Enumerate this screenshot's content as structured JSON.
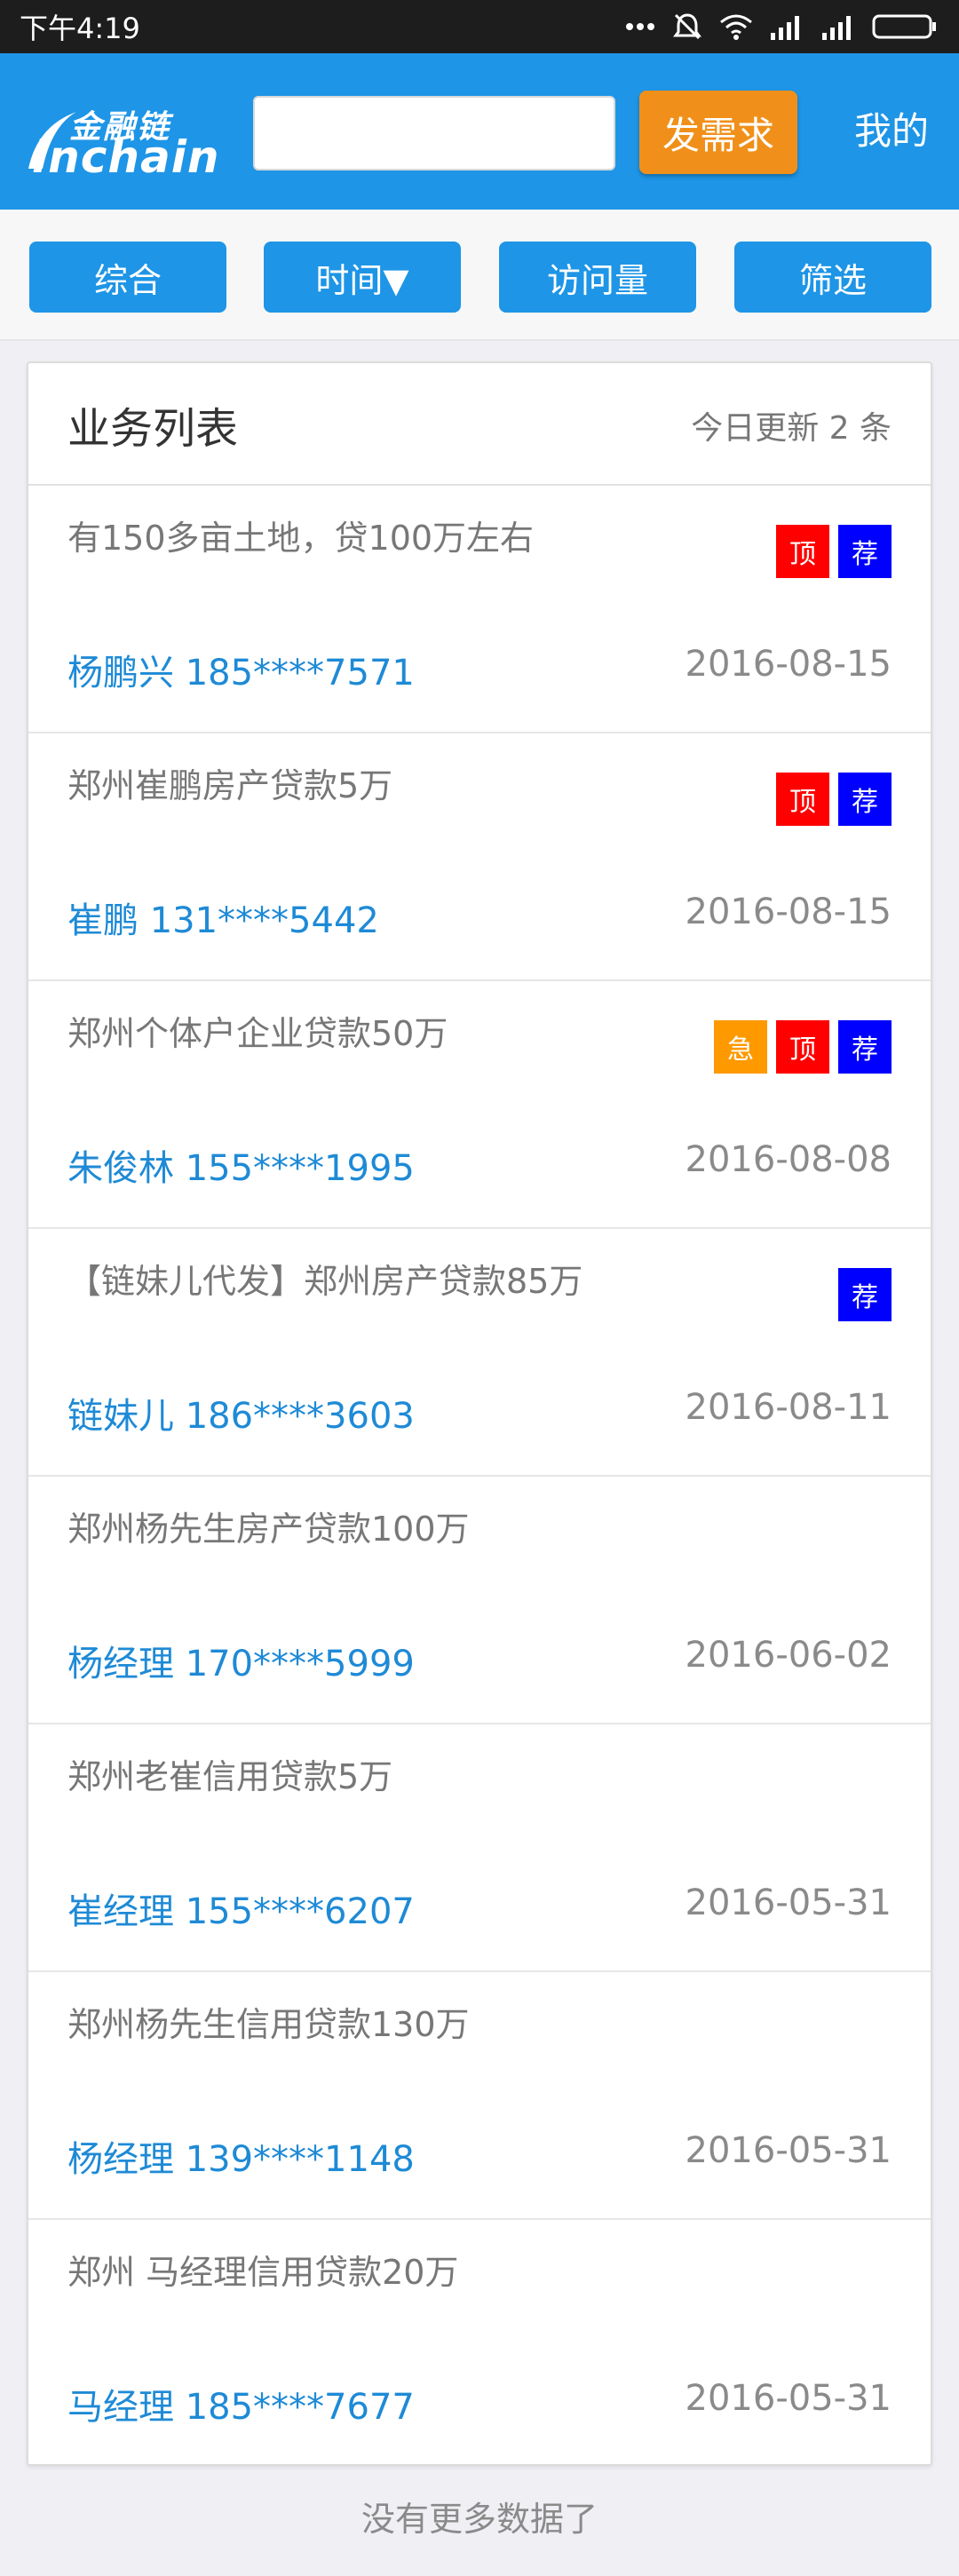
{
  "status_bar": {
    "time": "下午4:19"
  },
  "header": {
    "logo_cn": "金融链",
    "logo_en": "inchain",
    "search_placeholder": "",
    "post_button": "发需求",
    "mine_link": "我的"
  },
  "filters": [
    "综合",
    "时间▼",
    "访问量",
    "筛选"
  ],
  "list": {
    "title": "业务列表",
    "updated_text": "今日更新 2 条",
    "items": [
      {
        "title": "有150多亩土地，贷100万左右",
        "contact": "杨鹏兴 185****7571",
        "date": "2016-08-15",
        "tags": [
          "顶",
          "荐"
        ]
      },
      {
        "title": "郑州崔鹏房产贷款5万",
        "contact": "崔鹏 131****5442",
        "date": "2016-08-15",
        "tags": [
          "顶",
          "荐"
        ]
      },
      {
        "title": "郑州个体户企业贷款50万",
        "contact": "朱俊林 155****1995",
        "date": "2016-08-08",
        "tags": [
          "急",
          "顶",
          "荐"
        ]
      },
      {
        "title": "【链妹儿代发】郑州房产贷款85万",
        "contact": "链妹儿 186****3603",
        "date": "2016-08-11",
        "tags": [
          "荐"
        ]
      },
      {
        "title": "郑州杨先生房产贷款100万",
        "contact": "杨经理 170****5999",
        "date": "2016-06-02",
        "tags": []
      },
      {
        "title": "郑州老崔信用贷款5万",
        "contact": "崔经理 155****6207",
        "date": "2016-05-31",
        "tags": []
      },
      {
        "title": "郑州杨先生信用贷款130万",
        "contact": "杨经理 139****1148",
        "date": "2016-05-31",
        "tags": []
      },
      {
        "title": "郑州 马经理信用贷款20万",
        "contact": "马经理 185****7677",
        "date": "2016-05-31",
        "tags": []
      }
    ]
  },
  "footer": {
    "no_more": "没有更多数据了"
  },
  "colors": {
    "header_bg": "#1e95e6",
    "post_button_bg": "#f0901a",
    "tag_urgent": "#ff9900",
    "tag_top": "#ff0000",
    "tag_recommend": "#0000ff",
    "contact_text": "#1e8ad6"
  }
}
